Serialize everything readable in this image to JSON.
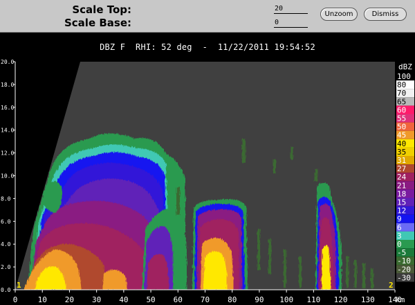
{
  "controls": {
    "scale_top_label": "Scale Top:",
    "scale_top_value": "20",
    "scale_base_label": "Scale Base:",
    "scale_base_value": "0",
    "unzoom_label": "Unzoom",
    "dismiss_label": "Dismiss"
  },
  "title": "DBZ F  RHI: 52 deg  -  11/22/2011 19:54:52",
  "markers": {
    "left": "1",
    "right": "2"
  },
  "chart_data": {
    "type": "heatmap",
    "title": "DBZ F  RHI: 52 deg  -  11/22/2011 19:54:52",
    "xlabel": "km",
    "ylabel": "",
    "xlim": [
      0,
      140
    ],
    "ylim": [
      0,
      20
    ],
    "x_ticks": [
      0,
      10,
      20,
      30,
      40,
      50,
      60,
      70,
      80,
      90,
      100,
      110,
      120,
      130,
      140
    ],
    "x_tick_labels": [
      "0",
      "10",
      "20",
      "30",
      "40",
      "50",
      "60",
      "70",
      "80",
      "90",
      "100",
      "110",
      "120",
      "130",
      "140"
    ],
    "y_ticks": [
      0,
      2,
      4,
      6,
      8,
      10,
      12,
      14,
      16,
      18,
      20
    ],
    "y_tick_labels": [
      "0.0",
      "2.0",
      "4.0",
      "6.0",
      "8.0",
      "10.0",
      "12.0",
      "14.0",
      "16.0",
      "18.0",
      "20.0"
    ],
    "x_unit_label": "km",
    "colorbar": {
      "title": "dBZ",
      "levels": [
        {
          "label": "100",
          "color": "#000000"
        },
        {
          "label": "80",
          "color": "#ffffff"
        },
        {
          "label": "70",
          "color": "#f2f2f2"
        },
        {
          "label": "65",
          "color": "#b8b8b8"
        },
        {
          "label": "60",
          "color": "#ff1a6a"
        },
        {
          "label": "55",
          "color": "#e0307a"
        },
        {
          "label": "50",
          "color": "#f0643c"
        },
        {
          "label": "45",
          "color": "#f09a2a"
        },
        {
          "label": "40",
          "color": "#ffe800"
        },
        {
          "label": "35",
          "color": "#f0d000"
        },
        {
          "label": "31",
          "color": "#e0a800"
        },
        {
          "label": "27",
          "color": "#b0482e"
        },
        {
          "label": "24",
          "color": "#a02060"
        },
        {
          "label": "21",
          "color": "#8a1a82"
        },
        {
          "label": "18",
          "color": "#7a1aa0"
        },
        {
          "label": "15",
          "color": "#6020b8"
        },
        {
          "label": "12",
          "color": "#3018d8"
        },
        {
          "label": "9",
          "color": "#1414f0"
        },
        {
          "label": "6",
          "color": "#6a6af5"
        },
        {
          "label": "3",
          "color": "#40c8b4"
        },
        {
          "label": "0",
          "color": "#2a9a50"
        },
        {
          "label": "-5",
          "color": "#1a7a3a"
        },
        {
          "label": "-10",
          "color": "#3a6a30"
        },
        {
          "label": "-20",
          "color": "#4a5a38"
        },
        {
          "label": "-30",
          "color": "#3c3c3c"
        }
      ]
    },
    "background_color": "#404040",
    "blocked_sector_color": "#000000"
  }
}
